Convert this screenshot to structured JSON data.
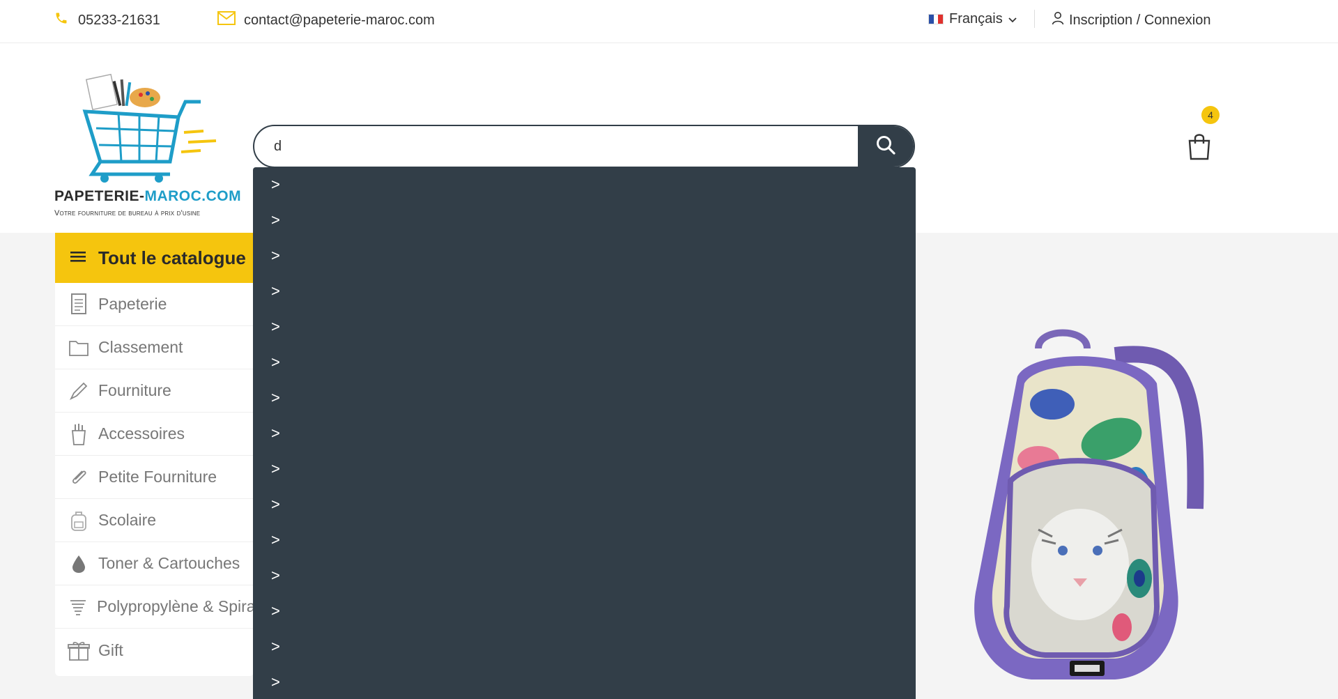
{
  "topbar": {
    "phone": "05233-21631",
    "email": "contact@papeterie-maroc.com",
    "language": "Français",
    "account": "Inscription / Connexion"
  },
  "brand": {
    "name_part1": "PAPETERIE-",
    "name_part2": "MAROC.COM",
    "tagline": "Votre fourniture de bureau à prix d'usine",
    "accent_color": "#1e9dc8",
    "highlight_color": "#f5c50e"
  },
  "search": {
    "value": "d",
    "button_icon": "search-icon"
  },
  "cart": {
    "count": "4",
    "icon": "shopping-bag-icon"
  },
  "catalog": {
    "title": "Tout le catalogue",
    "items": [
      {
        "label": "Papeterie",
        "icon": "paper-icon"
      },
      {
        "label": "Classement",
        "icon": "folder-icon"
      },
      {
        "label": "Fourniture",
        "icon": "pencil-icon"
      },
      {
        "label": "Accessoires",
        "icon": "pen-holder-icon"
      },
      {
        "label": "Petite Fourniture",
        "icon": "paperclip-icon"
      },
      {
        "label": "Scolaire",
        "icon": "backpack-icon"
      },
      {
        "label": "Toner & Cartouches",
        "icon": "ink-drop-icon"
      },
      {
        "label": "Polypropylène & Spirale",
        "icon": "spiral-icon"
      },
      {
        "label": "Gift",
        "icon": "gift-icon"
      }
    ]
  },
  "suggestions": [
    ">",
    ">",
    ">",
    ">",
    ">",
    ">",
    ">",
    ">",
    ">",
    ">",
    ">",
    ">",
    ">",
    ">",
    ">"
  ]
}
